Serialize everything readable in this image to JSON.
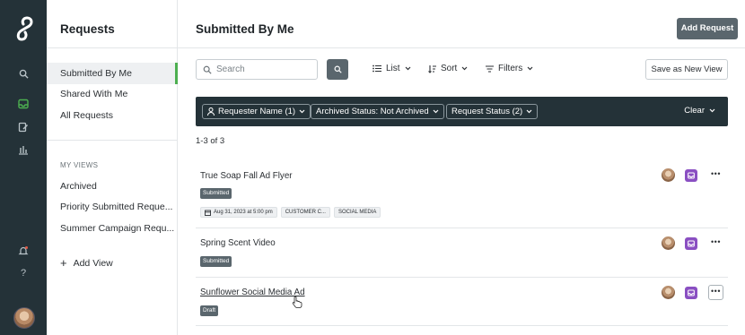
{
  "rail": {
    "icons": [
      "search-icon",
      "inbox-icon",
      "edit-icon",
      "chart-icon",
      "bell-icon",
      "help-icon"
    ],
    "help_label": "?"
  },
  "sidebar": {
    "title": "Requests",
    "items": [
      {
        "label": "Submitted By Me",
        "active": true
      },
      {
        "label": "Shared With Me"
      },
      {
        "label": "All Requests"
      }
    ],
    "section_label": "MY VIEWS",
    "views": [
      {
        "label": "Archived"
      },
      {
        "label": "Priority Submitted Reque..."
      },
      {
        "label": "Summer Campaign Requ..."
      }
    ],
    "add_view_label": "Add View"
  },
  "header": {
    "title": "Submitted By Me",
    "add_request_label": "Add Request"
  },
  "toolbar": {
    "search_placeholder": "Search",
    "list_label": "List",
    "sort_label": "Sort",
    "filters_label": "Filters",
    "save_view_label": "Save as New View"
  },
  "filters": {
    "chips": [
      {
        "label": "Requester Name (1)"
      },
      {
        "label": "Archived Status: Not Archived"
      },
      {
        "label": "Request Status (2)"
      }
    ],
    "clear_label": "Clear"
  },
  "results": {
    "count_label": "1-3 of 3"
  },
  "rows": [
    {
      "title": "True Soap Fall Ad Flyer",
      "status": "Submitted",
      "due": "Aug 31, 2023 at 5:00 pm",
      "tags": [
        "CUSTOMER C...",
        "SOCIAL MEDIA"
      ]
    },
    {
      "title": "Spring Scent Video",
      "status": "Submitted"
    },
    {
      "title": "Sunflower Social Media Ad",
      "status": "Draft"
    }
  ],
  "colors": {
    "rail_bg": "#243238",
    "active_indicator": "#4caf50",
    "primary_button": "#5a666d",
    "inbox_badge": "#8a4fc2"
  }
}
